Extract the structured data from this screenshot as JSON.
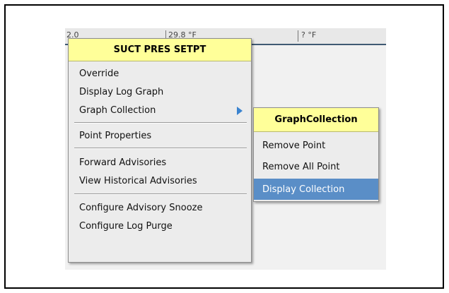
{
  "background_strip": {
    "cells": [
      "2.0",
      "29.8 °F",
      "? °F"
    ]
  },
  "context_menu": {
    "title": "SUCT PRES SETPT",
    "items": [
      {
        "label": "Override"
      },
      {
        "label": "Display Log Graph"
      },
      {
        "label": "Graph Collection",
        "has_submenu": true
      },
      {
        "label": "Point Properties"
      },
      {
        "label": "Forward Advisories"
      },
      {
        "label": "View Historical Advisories"
      },
      {
        "label": "Configure Advisory Snooze"
      },
      {
        "label": "Configure Log Purge"
      }
    ]
  },
  "submenu": {
    "title": "GraphCollection",
    "items": [
      {
        "label": "Remove Point"
      },
      {
        "label": "Remove All Point"
      },
      {
        "label": "Display Collection",
        "highlighted": true
      }
    ]
  },
  "colors": {
    "header_yellow": "#ffff99",
    "menu_bg": "#ececec",
    "highlight": "#5a8ec7",
    "submenu_arrow": "#3a83cf"
  },
  "icons": {
    "submenu_arrow": "chevron-right-icon"
  }
}
